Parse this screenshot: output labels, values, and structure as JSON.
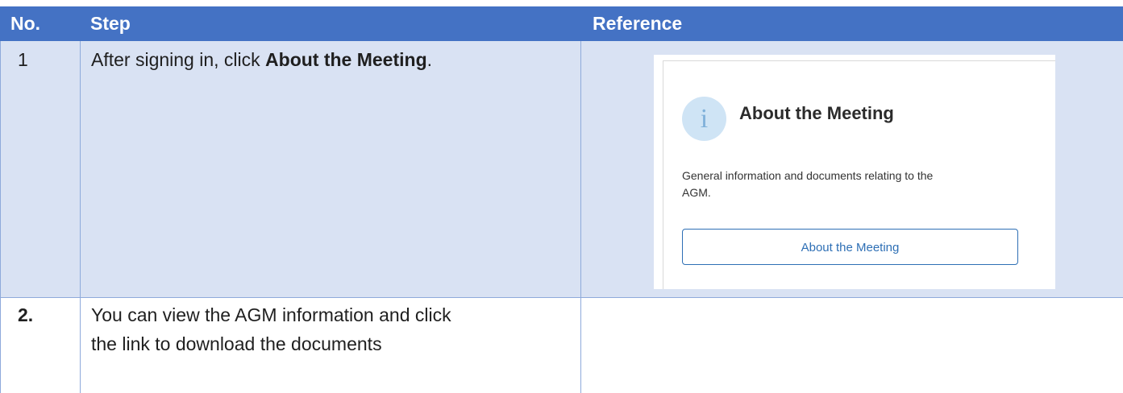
{
  "table": {
    "headers": {
      "no": "No.",
      "step": "Step",
      "reference": "Reference"
    },
    "rows": [
      {
        "no": "1",
        "step_prefix": "After signing in, click ",
        "step_bold": "About the Meeting",
        "step_suffix": "."
      },
      {
        "no": "2.",
        "step_line1": "You can view the AGM information and click",
        "step_line2": "the link to download the documents"
      }
    ]
  },
  "reference_card": {
    "icon": "info-icon",
    "icon_glyph": "i",
    "title": "About the Meeting",
    "description_line1": "General information and documents relating to the",
    "description_line2": "AGM.",
    "button_label": "About the Meeting"
  },
  "colors": {
    "header_bg": "#4472c4",
    "row_bg": "#d9e2f3",
    "border": "#8eaadb",
    "button_accent": "#2e6fb5",
    "info_circle": "#cfe4f5"
  }
}
